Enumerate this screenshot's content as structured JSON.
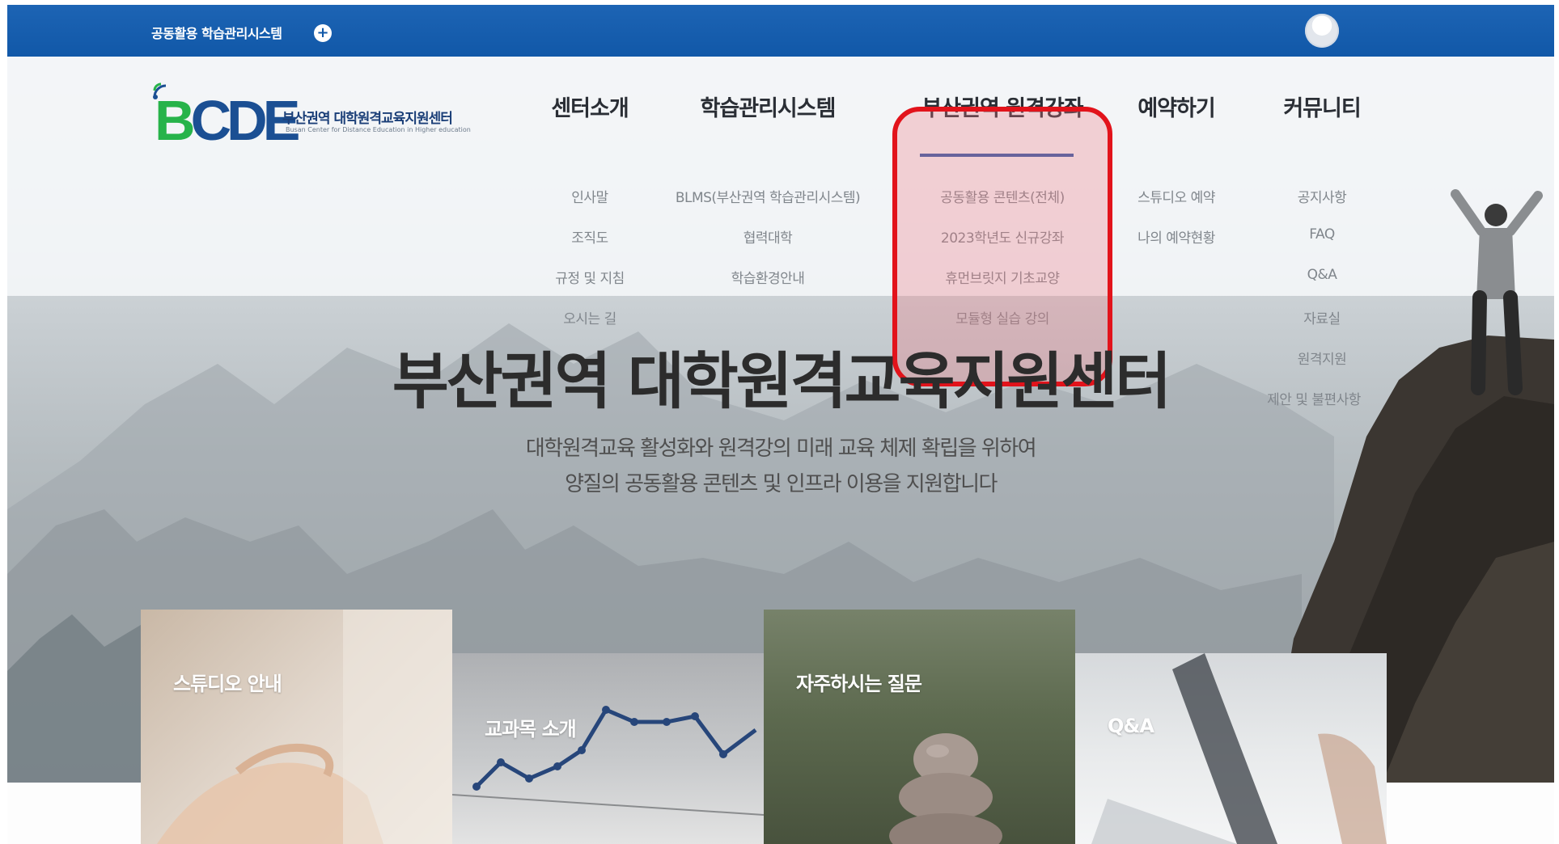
{
  "topbar": {
    "system_link": "공동활용 학습관리시스템",
    "plus_icon": "plus-circle-icon",
    "avatar_icon": "user-avatar-icon"
  },
  "logo": {
    "letters": [
      "B",
      "C",
      "D",
      "E"
    ],
    "org_name": "부산권역 대학원격교육지원센터",
    "org_english": "Busan Center for Distance Education in Higher education"
  },
  "nav": {
    "menus": [
      {
        "label": "센터소개",
        "items": [
          "인사말",
          "조직도",
          "규정 및 지침",
          "오시는 길"
        ]
      },
      {
        "label": "학습관리시스템",
        "items": [
          "BLMS(부산권역 학습관리시스템)",
          "협력대학",
          "학습환경안내"
        ]
      },
      {
        "label": "부산권역 원격강좌",
        "items": [
          "공동활용 콘텐츠(전체)",
          "2023학년도 신규강좌",
          "휴먼브릿지 기초교양",
          "모듈형 실습 강의"
        ]
      },
      {
        "label": "예약하기",
        "items": [
          "스튜디오 예약",
          "나의 예약현황"
        ]
      },
      {
        "label": "커뮤니티",
        "items": [
          "공지사항",
          "FAQ",
          "Q&A",
          "자료실",
          "원격지원",
          "제안 및 불편사항"
        ]
      }
    ]
  },
  "hero": {
    "title": "부산권역 대학원격교육지원센터",
    "subtitle_line1": "대학원격교육 활성화와 원격강의 미래 교육 체제 확립을 위하여",
    "subtitle_line2": "양질의 공동활용 콘텐츠 및 인프라 이용을 지원합니다"
  },
  "cards": [
    {
      "label": "스튜디오 안내"
    },
    {
      "label": "교과목 소개"
    },
    {
      "label": "자주하시는 질문"
    },
    {
      "label": "Q&A"
    }
  ],
  "colors": {
    "topbar": "#1158a8",
    "highlight_border": "#e2131b",
    "nav_underline": "#2e5ba8",
    "logo_green": "#27b34a",
    "logo_blue": "#1b4f93"
  }
}
